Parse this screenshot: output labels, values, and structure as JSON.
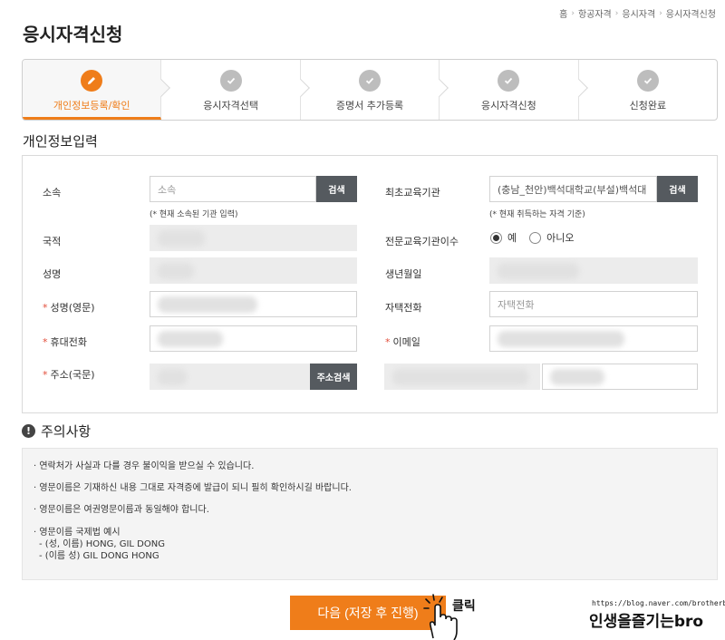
{
  "breadcrumb": [
    "홈",
    "항공자격",
    "응시자격",
    "응시자격신청"
  ],
  "page_title": "응시자격신청",
  "steps": [
    {
      "label": "개인정보등록/확인",
      "active": true,
      "icon": "pencil-icon"
    },
    {
      "label": "응시자격선택",
      "active": false,
      "icon": "check-icon"
    },
    {
      "label": "증명서 추가등록",
      "active": false,
      "icon": "check-icon"
    },
    {
      "label": "응시자격신청",
      "active": false,
      "icon": "check-icon"
    },
    {
      "label": "신청완료",
      "active": false,
      "icon": "check-icon"
    }
  ],
  "section_title": "개인정보입력",
  "form": {
    "affiliation": {
      "label": "소속",
      "placeholder": "소속",
      "button": "검색",
      "hint": "(* 현재 소속된 기관 입력)"
    },
    "first_edu": {
      "label": "최초교육기관",
      "value": "(충남_천안)백석대학교(부설)백석대",
      "button": "검색",
      "hint": "(* 현재 취득하는 자격 기준)"
    },
    "nationality": {
      "label": "국적"
    },
    "specialized_edu": {
      "label": "전문교육기관이수",
      "yes": "예",
      "no": "아니오",
      "selected": "예"
    },
    "name": {
      "label": "성명"
    },
    "birth": {
      "label": "생년월일"
    },
    "name_en": {
      "label": "성명(영문)",
      "required_mark": "*"
    },
    "home_phone": {
      "label": "자택전화",
      "placeholder": "자택전화"
    },
    "mobile": {
      "label": "휴대전화",
      "required_mark": "*"
    },
    "email": {
      "label": "이메일",
      "required_mark": "*"
    },
    "address": {
      "label": "주소(국문)",
      "required_mark": "*",
      "button": "주소검색"
    }
  },
  "notice": {
    "title": "주의사항",
    "items": [
      "· 연락처가 사실과 다를 경우 불이익을 받으실 수 있습니다.",
      "· 영문이름은 기재하신 내용 그대로 자격증에 발급이 되니 필히 확인하시길 바랍니다.",
      "· 영문이름은 여권영문이름과 동일해야 합니다."
    ],
    "example_title": "· 영문이름 국제법 예시",
    "examples": [
      "- (성, 이름) HONG, GIL DONG",
      "- (이름 성) GIL DONG HONG"
    ]
  },
  "next_button": "다음 (저장 후 진행)",
  "click_annotation": "클릭",
  "blog": {
    "url": "https://blog.naver.com/brotherb",
    "name": "인생을즐기는bro"
  },
  "colors": {
    "accent": "#ef7d1a",
    "dark_button": "#555a5f"
  }
}
